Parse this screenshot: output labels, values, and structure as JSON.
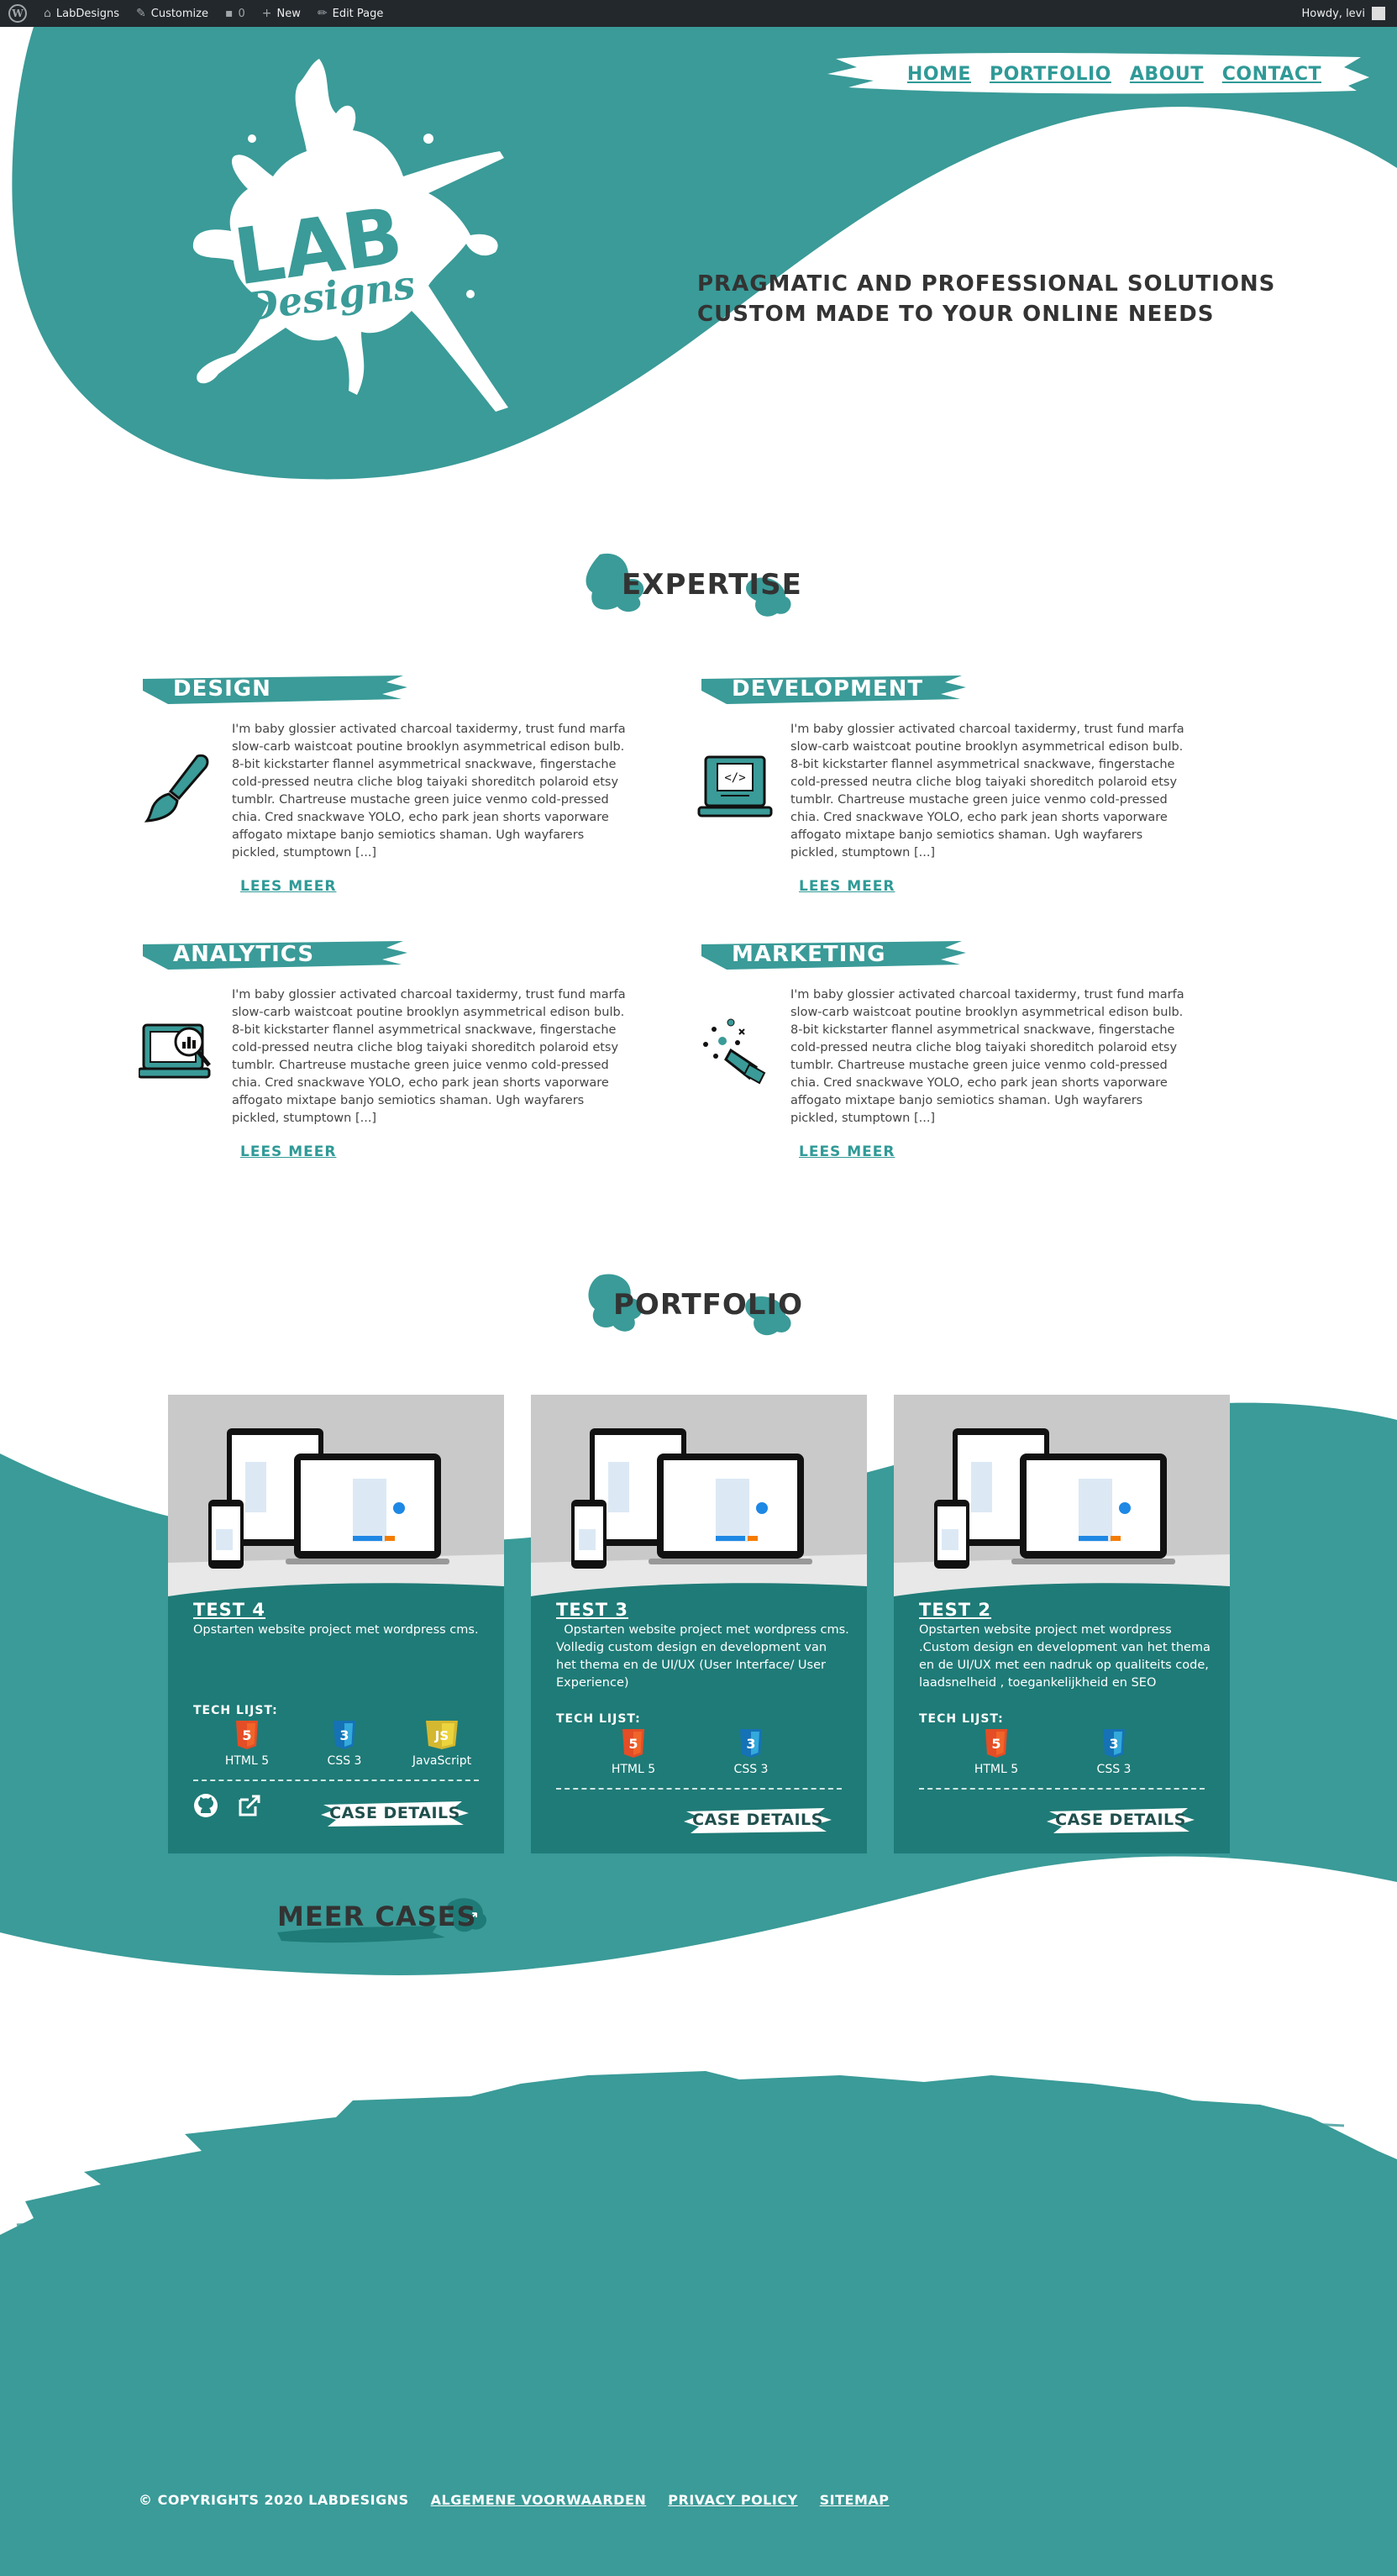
{
  "adminbar": {
    "site_name": "LabDesigns",
    "customize": "Customize",
    "comments": "0",
    "new": "New",
    "edit_page": "Edit Page",
    "howdy": "Howdy, levi"
  },
  "nav": {
    "items": [
      "HOME",
      "PORTFOLIO",
      "ABOUT",
      "CONTACT"
    ]
  },
  "logo": {
    "line1": "LAB",
    "line2": "Designs"
  },
  "hero": {
    "tagline_1": "PRAGMATIC AND PROFESSIONAL SOLUTIONS",
    "tagline_2": "CUSTOM MADE TO YOUR ONLINE NEEDS"
  },
  "expertise": {
    "title": "EXPERTISE",
    "read_more": "LEES MEER",
    "items": [
      {
        "title": "DESIGN",
        "icon": "paintbrush-icon",
        "text": "I'm baby glossier activated charcoal taxidermy, trust fund marfa slow-carb waistcoat poutine brooklyn asymmetrical edison bulb. 8-bit kickstarter flannel asymmetrical snackwave, fingerstache cold-pressed neutra cliche blog taiyaki shoreditch polaroid etsy tumblr. Chartreuse mustache green juice venmo cold-pressed chia. Cred snackwave YOLO, echo park jean shorts vaporware affogato mixtape banjo semiotics shaman. Ugh wayfarers pickled, stumptown [...]"
      },
      {
        "title": "DEVELOPMENT",
        "icon": "code-laptop-icon",
        "text": "I'm baby glossier activated charcoal taxidermy, trust fund marfa slow-carb waistcoat poutine brooklyn asymmetrical edison bulb. 8-bit kickstarter flannel asymmetrical snackwave, fingerstache cold-pressed neutra cliche blog taiyaki shoreditch polaroid etsy tumblr. Chartreuse mustache green juice venmo cold-pressed chia. Cred snackwave YOLO, echo park jean shorts vaporware affogato mixtape banjo semiotics shaman. Ugh wayfarers pickled, stumptown [...]"
      },
      {
        "title": "ANALYTICS",
        "icon": "analytics-laptop-icon",
        "text": "I'm baby glossier activated charcoal taxidermy, trust fund marfa slow-carb waistcoat poutine brooklyn asymmetrical edison bulb. 8-bit kickstarter flannel asymmetrical snackwave, fingerstache cold-pressed neutra cliche blog taiyaki shoreditch polaroid etsy tumblr. Chartreuse mustache green juice venmo cold-pressed chia. Cred snackwave YOLO, echo park jean shorts vaporware affogato mixtape banjo semiotics shaman. Ugh wayfarers pickled, stumptown [...]"
      },
      {
        "title": "MARKETING",
        "icon": "megaphone-icon",
        "text": "I'm baby glossier activated charcoal taxidermy, trust fund marfa slow-carb waistcoat poutine brooklyn asymmetrical edison bulb. 8-bit kickstarter flannel asymmetrical snackwave, fingerstache cold-pressed neutra cliche blog taiyaki shoreditch polaroid etsy tumblr. Chartreuse mustache green juice venmo cold-pressed chia. Cred snackwave YOLO, echo park jean shorts vaporware affogato mixtape banjo semiotics shaman. Ugh wayfarers pickled, stumptown [...]"
      }
    ]
  },
  "portfolio": {
    "title": "PORTFOLIO",
    "tech_heading": "TECH LIJST:",
    "case_button": "CASE DETAILS",
    "cards": [
      {
        "title": "TEST 4",
        "desc": "Opstarten website project met wordpress cms.",
        "techs": [
          {
            "name": "HTML 5",
            "icon": "html5-icon"
          },
          {
            "name": "CSS 3",
            "icon": "css3-icon"
          },
          {
            "name": "JavaScript",
            "icon": "javascript-icon"
          }
        ],
        "has_links": true
      },
      {
        "title": "TEST 3",
        "desc": "  Opstarten website project met wordpress cms. Volledig custom design en development van het thema en de UI/UX (User Interface/ User Experience)",
        "techs": [
          {
            "name": "HTML 5",
            "icon": "html5-icon"
          },
          {
            "name": "CSS 3",
            "icon": "css3-icon"
          }
        ],
        "has_links": false
      },
      {
        "title": "TEST 2",
        "desc": "Opstarten website project met wordpress .Custom design en development van het thema en de UI/UX met een nadruk op qualiteits code, laadsnelheid , toegankelijkheid en SEO",
        "techs": [
          {
            "name": "HTML 5",
            "icon": "html5-icon"
          },
          {
            "name": "CSS 3",
            "icon": "css3-icon"
          }
        ],
        "has_links": false
      }
    ],
    "more_cases": "MEER CASES"
  },
  "footer": {
    "copyright": "© COPYRIGHTS 2020 LABDESIGNS",
    "links": [
      "ALGEMENE VOORWAARDEN",
      "PRIVACY POLICY",
      "SITEMAP"
    ]
  },
  "colors": {
    "teal": "#3a9b98",
    "dark_teal": "#1f7b77",
    "text": "#333333"
  }
}
